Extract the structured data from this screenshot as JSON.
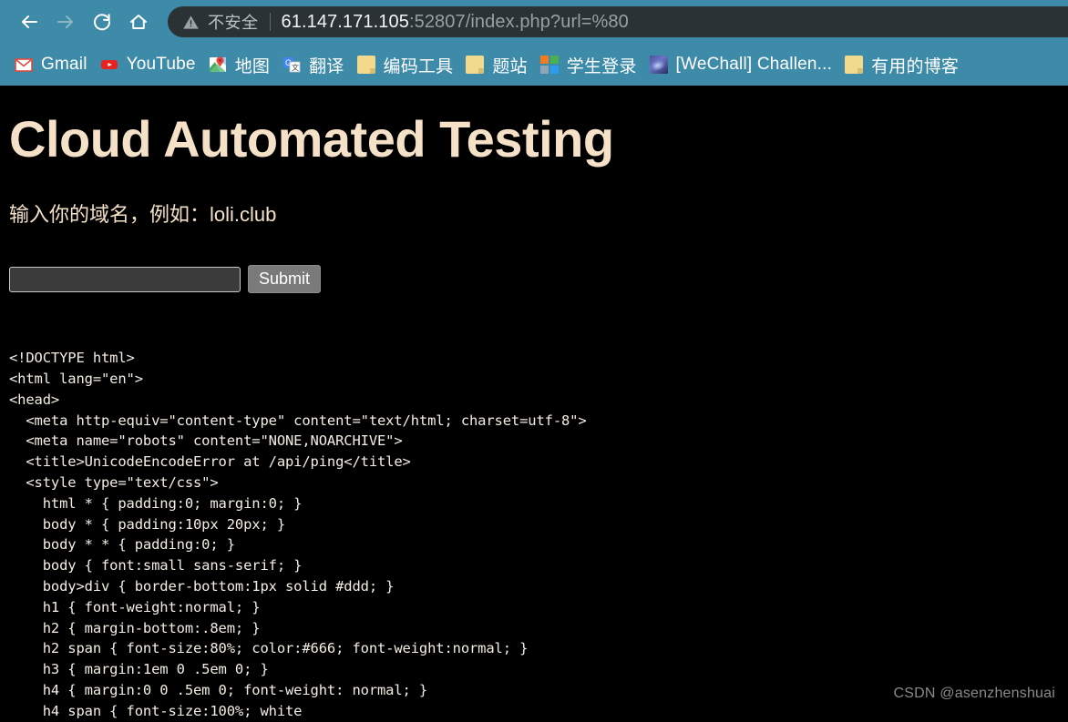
{
  "browser": {
    "nav": {
      "back_label": "Back",
      "forward_label": "Forward",
      "reload_label": "Reload",
      "home_label": "Home"
    },
    "omnibox": {
      "security_icon": "warning-triangle-icon",
      "security_text": "不安全",
      "url_host": "61.147.171.105",
      "url_rest": ":52807/index.php?url=%80",
      "full_url": "61.147.171.105:52807/index.php?url=%80"
    },
    "bookmarks": [
      {
        "label": "Gmail",
        "icon": "gmail-icon"
      },
      {
        "label": "YouTube",
        "icon": "youtube-icon"
      },
      {
        "label": "地图",
        "icon": "google-maps-icon"
      },
      {
        "label": "翻译",
        "icon": "google-translate-icon"
      },
      {
        "label": "编码工具",
        "icon": "folder-icon"
      },
      {
        "label": "题站",
        "icon": "folder-icon"
      },
      {
        "label": "学生登录",
        "icon": "windows-icon"
      },
      {
        "label": "[WeChall] Challen...",
        "icon": "wechall-icon"
      },
      {
        "label": "有用的博客",
        "icon": "folder-icon"
      }
    ],
    "colors": {
      "toolbar_bg": "#3d8ba8",
      "omnibox_bg": "#2a3236",
      "bookmark_text": "#ffffff"
    }
  },
  "page": {
    "title": "Cloud Automated Testing",
    "subtitle": "输入你的域名，例如：loli.club",
    "form": {
      "input_value": "",
      "input_placeholder": "",
      "submit_label": "Submit"
    },
    "code_output": "<!DOCTYPE html>\n<html lang=\"en\">\n<head>\n  <meta http-equiv=\"content-type\" content=\"text/html; charset=utf-8\">\n  <meta name=\"robots\" content=\"NONE,NOARCHIVE\">\n  <title>UnicodeEncodeError at /api/ping</title>\n  <style type=\"text/css\">\n    html * { padding:0; margin:0; }\n    body * { padding:10px 20px; }\n    body * * { padding:0; }\n    body { font:small sans-serif; }\n    body>div { border-bottom:1px solid #ddd; }\n    h1 { font-weight:normal; }\n    h2 { margin-bottom:.8em; }\n    h2 span { font-size:80%; color:#666; font-weight:normal; }\n    h3 { margin:1em 0 .5em 0; }\n    h4 { margin:0 0 .5em 0; font-weight: normal; }\n    h4 span { font-size:100%; white",
    "colors": {
      "background": "#000000",
      "heading": "#f5e0c8",
      "code_text": "#f3ede2"
    }
  },
  "watermark": {
    "text": "CSDN @asenzhenshuai"
  }
}
